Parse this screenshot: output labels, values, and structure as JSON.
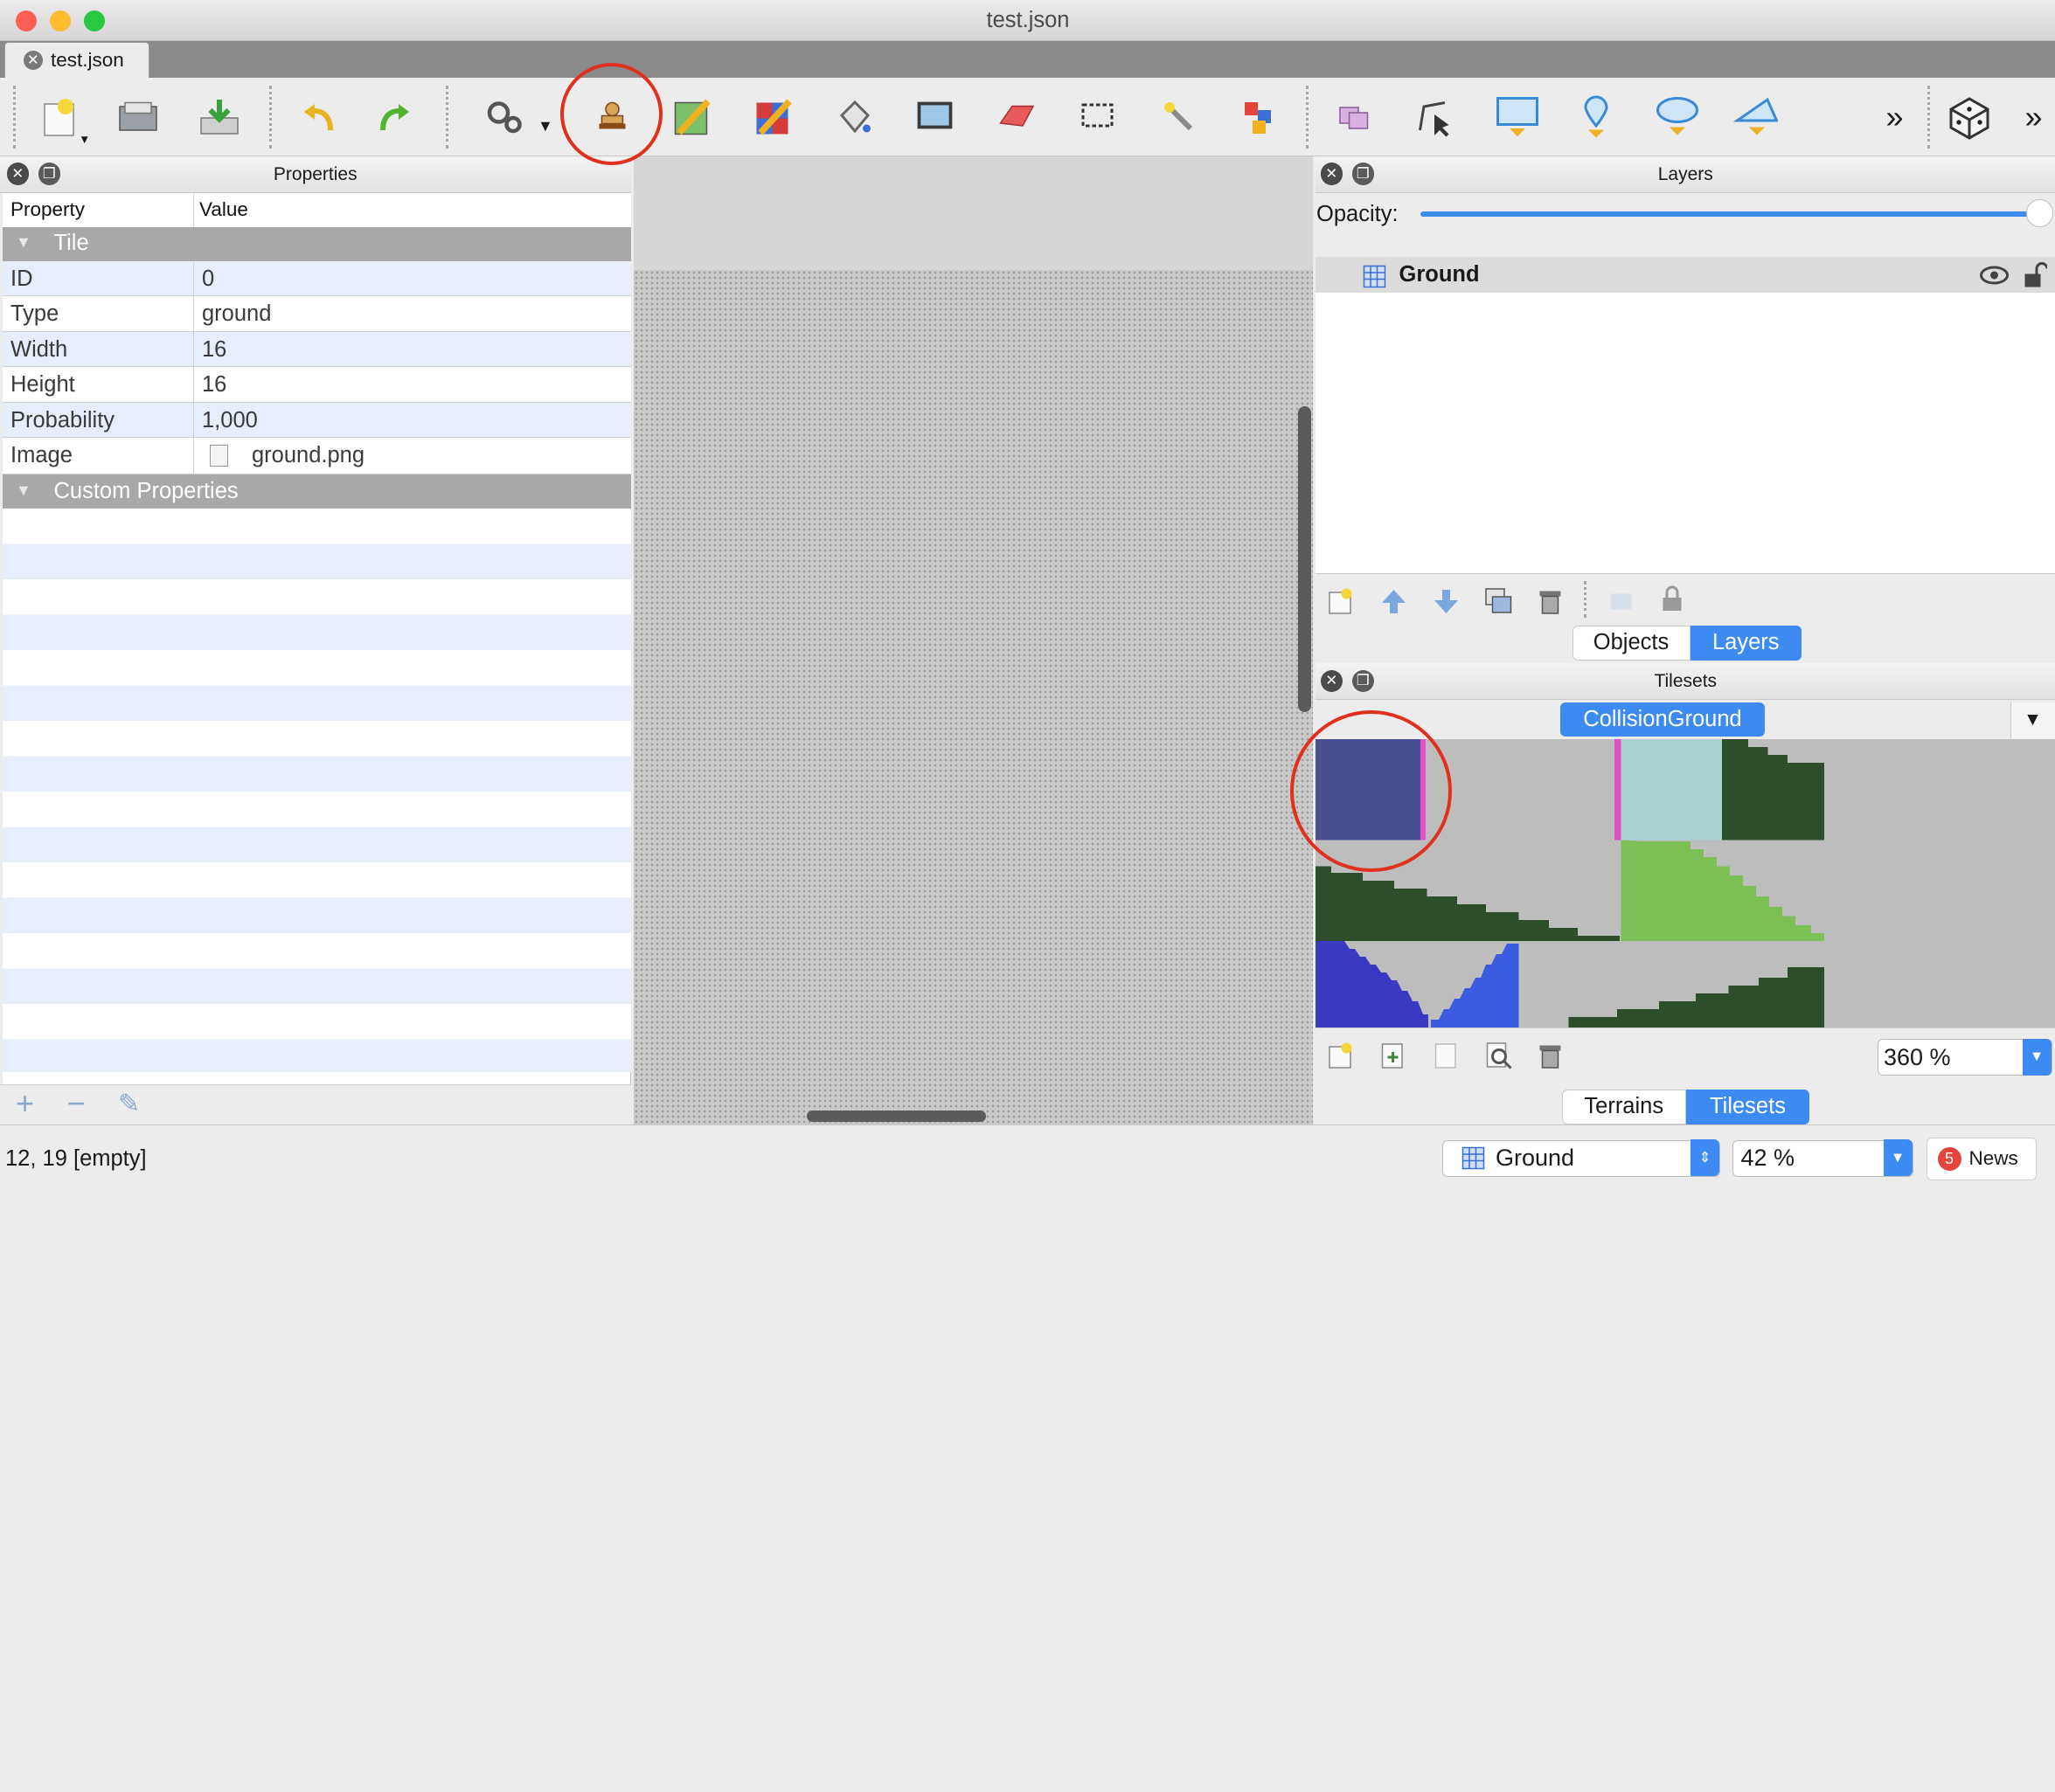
{
  "window": {
    "title": "test.json"
  },
  "tab": {
    "label": "test.json"
  },
  "properties": {
    "title": "Properties",
    "col_property": "Property",
    "col_value": "Value",
    "group_tile": "Tile",
    "rows": [
      {
        "key": "ID",
        "value": "0"
      },
      {
        "key": "Type",
        "value": "ground"
      },
      {
        "key": "Width",
        "value": "16"
      },
      {
        "key": "Height",
        "value": "16"
      },
      {
        "key": "Probability",
        "value": "1,000"
      },
      {
        "key": "Image",
        "value": "ground.png"
      }
    ],
    "group_custom": "Custom Properties"
  },
  "layers": {
    "title": "Layers",
    "opacity_label": "Opacity:",
    "opacity_value": 1.0,
    "items": [
      {
        "name": "Ground"
      }
    ]
  },
  "dock_tabs_top": [
    "Objects",
    "Layers"
  ],
  "tilesets": {
    "title": "Tilesets",
    "current": "CollisionGround",
    "zoom": "360 %"
  },
  "dock_tabs_bottom": [
    "Terrains",
    "Tilesets"
  ],
  "status": {
    "position": "12, 19 [empty]",
    "layer": "Ground",
    "zoom": "42 %",
    "news_count": "5",
    "news_label": "News"
  },
  "colors": {
    "accent": "#3d8bf2",
    "highlight_ring": "#e0301e",
    "tile_blue": "#4a4f93",
    "tile_teal": "#a8d3d0",
    "tile_dark_green": "#2d4d2b",
    "tile_light_green": "#7bbf55"
  }
}
